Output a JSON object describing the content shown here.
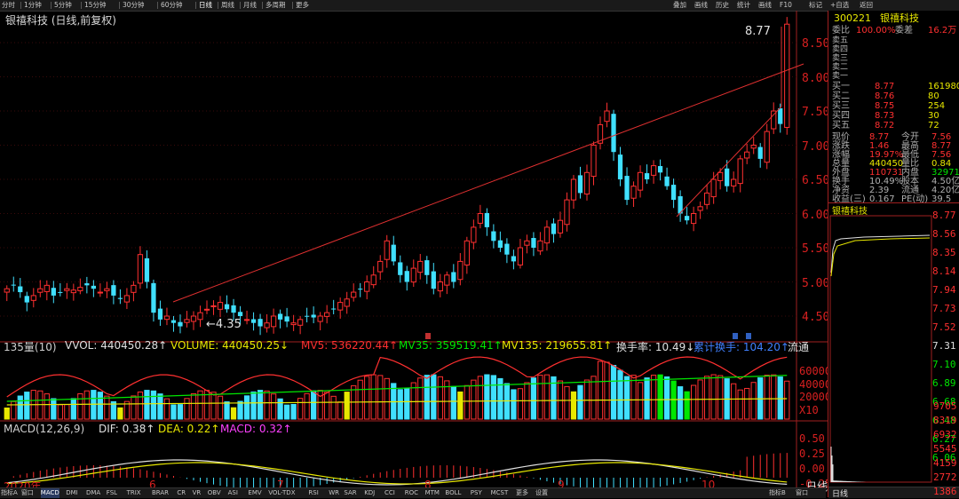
{
  "toolbar": {
    "items": [
      "分时",
      "1分钟",
      "5分钟",
      "15分钟",
      "30分钟",
      "60分钟",
      "日线",
      "周线",
      "月线",
      "多周期",
      "更多"
    ],
    "active": "日线",
    "right_items": [
      "叠加",
      "画线",
      "历史",
      "统计",
      "画线",
      "F10",
      "标记",
      "+自选",
      "返回"
    ]
  },
  "chart": {
    "title": "银禧科技 (日线,前复权)",
    "price_axis": [
      "8.50",
      "8.00",
      "7.50",
      "7.00",
      "6.50",
      "6.00",
      "5.50",
      "5.00",
      "4.50"
    ],
    "high_label": "8.77",
    "low_label": "4.35",
    "low_marker": "←",
    "event_marks": [
      "B",
      "B",
      "S"
    ],
    "vol_axis": [
      "60000",
      "40000",
      "20000",
      "X10"
    ],
    "macd_axis": [
      "0.50",
      "0.25",
      "0.00",
      "-0.25"
    ],
    "dates": [
      "2020年",
      "6",
      "7",
      "8",
      "9",
      "10",
      "日线"
    ]
  },
  "vol_indicators": {
    "label": "135量(10)",
    "vvol": "VVOL: 440450.28↑",
    "volume": "VOLUME: 440450.25↓",
    "mv5": "MV5: 536220.44↑",
    "mv35": "MV35: 359519.41↑",
    "mv135": "MV135: 219655.81↑",
    "turnover": "换手率: 10.49↓",
    "cum": "累计换手: 104.20↑",
    "flow": "流通"
  },
  "macd_indicators": {
    "label": "MACD(12,26,9)",
    "dif": "DIF: 0.38↑",
    "dea": "DEA: 0.22↑",
    "macd": "MACD: 0.32↑"
  },
  "panel": {
    "code": "300221",
    "name": "银禧科技",
    "weibi": "委比",
    "weibi_v": "100.00%",
    "weicha": "委差",
    "weicha_v": "16.2万",
    "sell": [
      "卖五",
      "卖四",
      "卖三",
      "卖二",
      "卖一"
    ],
    "buy": [
      {
        "label": "买一",
        "price": "8.77",
        "vol": "161980"
      },
      {
        "label": "买二",
        "price": "8.76",
        "vol": "80"
      },
      {
        "label": "买三",
        "price": "8.75",
        "vol": "254"
      },
      {
        "label": "买四",
        "price": "8.73",
        "vol": "30"
      },
      {
        "label": "买五",
        "price": "8.72",
        "vol": "72"
      }
    ],
    "stats": [
      {
        "l1": "现价",
        "v1": "8.77",
        "l2": "今开",
        "v2": "7.56",
        "c1": "red",
        "c2": "red"
      },
      {
        "l1": "涨跌",
        "v1": "1.46",
        "l2": "最高",
        "v2": "8.77",
        "c1": "red",
        "c2": "red"
      },
      {
        "l1": "涨幅",
        "v1": "19.97%",
        "l2": "最低",
        "v2": "7.56",
        "c1": "red",
        "c2": "red"
      },
      {
        "l1": "总量",
        "v1": "440450",
        "l2": "量比",
        "v2": "0.84",
        "c1": "yellow",
        "c2": "yellow"
      },
      {
        "l1": "外盘",
        "v1": "110731",
        "l2": "内盘",
        "v2": "329719",
        "c1": "red",
        "c2": "green"
      },
      {
        "l1": "换手",
        "v1": "10.49%",
        "l2": "股本",
        "v2": "4.50亿",
        "c1": "gray",
        "c2": "gray"
      },
      {
        "l1": "净资",
        "v1": "2.39",
        "l2": "流通",
        "v2": "4.20亿",
        "c1": "gray",
        "c2": "gray"
      },
      {
        "l1": "收益(三)",
        "v1": "0.167",
        "l2": "PE(动)",
        "v2": "39.5",
        "c1": "gray",
        "c2": "gray"
      }
    ],
    "intraday_title": "银禧科技",
    "intraday_axis": [
      "8.77",
      "8.56",
      "8.35",
      "8.14",
      "7.94",
      "7.73",
      "7.52",
      "7.31",
      "7.10",
      "6.89",
      "6.68",
      "6.48",
      "6.27",
      "6.06"
    ],
    "intraday_vol_axis": [
      "9705",
      "8319",
      "6932",
      "5545",
      "4159",
      "2772",
      "1386"
    ],
    "bottom_tab": "日线"
  },
  "bottom_tabs": [
    "指标A",
    "窗口",
    "MACD",
    "DMI",
    "DMA",
    "FSL",
    "TRIX",
    "BRAR",
    "CR",
    "VR",
    "OBV",
    "ASI",
    "EMV",
    "VOL-TDX",
    "RSI",
    "WR",
    "SAR",
    "KDJ",
    "CCI",
    "ROC",
    "MTM",
    "BOLL",
    "PSY",
    "MCST",
    "更多",
    "设置"
  ],
  "bottom_tab_selected": "MACD",
  "bottom_right_tabs": [
    "指标B",
    "窗口"
  ],
  "colors": {
    "up": "#ff3030",
    "down": "#40e0ff",
    "axis": "#d82020",
    "bg": "#000000"
  }
}
